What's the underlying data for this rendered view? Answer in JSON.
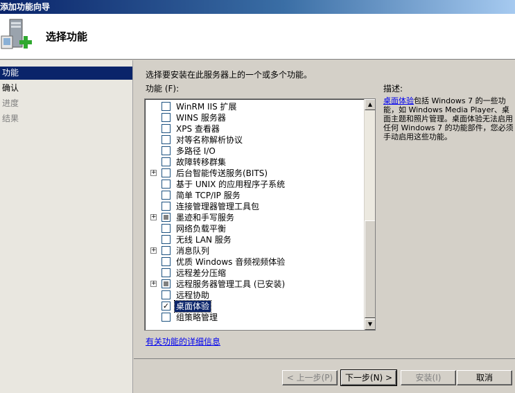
{
  "window": {
    "title": "添加功能向导"
  },
  "header": {
    "page_title": "选择功能",
    "icon": "server-add-icon"
  },
  "steps": [
    {
      "label": "功能",
      "state": "active"
    },
    {
      "label": "确认",
      "state": "normal"
    },
    {
      "label": "进度",
      "state": "disabled"
    },
    {
      "label": "结果",
      "state": "disabled"
    }
  ],
  "main": {
    "instruction": "选择要安装在此服务器上的一个或多个功能。",
    "features_label": "功能 (F):",
    "more_info_link": "有关功能的详细信息"
  },
  "features": [
    {
      "label": "WinRM IIS 扩展",
      "expandable": false,
      "state": "unchecked",
      "selected": false
    },
    {
      "label": "WINS 服务器",
      "expandable": false,
      "state": "unchecked",
      "selected": false
    },
    {
      "label": "XPS 查看器",
      "expandable": false,
      "state": "unchecked",
      "selected": false
    },
    {
      "label": "对等名称解析协议",
      "expandable": false,
      "state": "unchecked",
      "selected": false
    },
    {
      "label": "多路径 I/O",
      "expandable": false,
      "state": "unchecked",
      "selected": false
    },
    {
      "label": "故障转移群集",
      "expandable": false,
      "state": "unchecked",
      "selected": false
    },
    {
      "label": "后台智能传送服务(BITS)",
      "expandable": true,
      "state": "unchecked",
      "selected": false
    },
    {
      "label": "基于 UNIX 的应用程序子系统",
      "expandable": false,
      "state": "unchecked",
      "selected": false
    },
    {
      "label": "简单 TCP/IP 服务",
      "expandable": false,
      "state": "unchecked",
      "selected": false
    },
    {
      "label": "连接管理器管理工具包",
      "expandable": false,
      "state": "unchecked",
      "selected": false
    },
    {
      "label": "墨迹和手写服务",
      "expandable": true,
      "state": "partial",
      "selected": false
    },
    {
      "label": "网络负载平衡",
      "expandable": false,
      "state": "unchecked",
      "selected": false
    },
    {
      "label": "无线 LAN 服务",
      "expandable": false,
      "state": "unchecked",
      "selected": false
    },
    {
      "label": "消息队列",
      "expandable": true,
      "state": "unchecked",
      "selected": false
    },
    {
      "label": "优质 Windows 音频视频体验",
      "expandable": false,
      "state": "unchecked",
      "selected": false
    },
    {
      "label": "远程差分压缩",
      "expandable": false,
      "state": "unchecked",
      "selected": false
    },
    {
      "label": "远程服务器管理工具  (已安装)",
      "expandable": true,
      "state": "partial",
      "selected": false
    },
    {
      "label": "远程协助",
      "expandable": false,
      "state": "unchecked",
      "selected": false
    },
    {
      "label": "桌面体验",
      "expandable": false,
      "state": "checked",
      "selected": true
    },
    {
      "label": "组策略管理",
      "expandable": false,
      "state": "unchecked",
      "selected": false
    }
  ],
  "description": {
    "label": "描述:",
    "link": "桌面体验",
    "text": "包括 Windows 7 的一些功能，如 Windows Media Player、桌面主题和照片管理。桌面体验无法启用任何 Windows 7 的功能部件，您必须手动启用这些功能。"
  },
  "buttons": {
    "prev": "< 上一步(P)",
    "next": "下一步(N) >",
    "install": "安装(I)",
    "cancel": "取消"
  },
  "colors": {
    "accent": "#0a246a",
    "link": "#0000ee"
  }
}
